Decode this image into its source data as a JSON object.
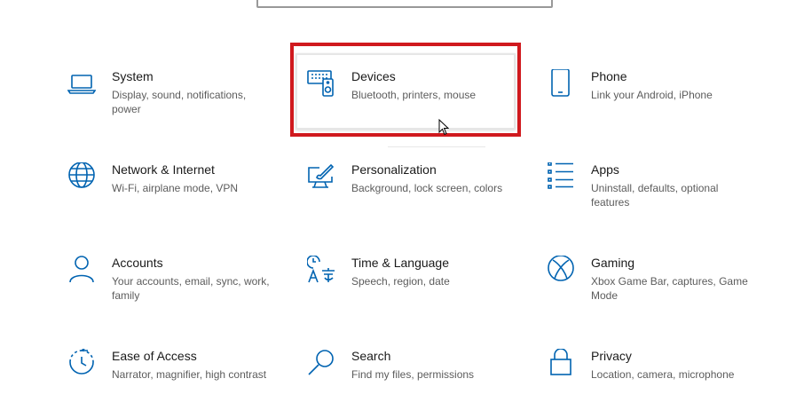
{
  "colors": {
    "accent": "#0063b1",
    "highlight": "#d0191e",
    "title_text": "#1a1a1a",
    "desc_text": "#5c5c5c"
  },
  "tiles": [
    {
      "title": "System",
      "description": "Display, sound, notifications, power",
      "icon": "laptop-icon"
    },
    {
      "title": "Devices",
      "description": "Bluetooth, printers, mouse",
      "icon": "devices-icon"
    },
    {
      "title": "Phone",
      "description": "Link your Android, iPhone",
      "icon": "phone-icon"
    },
    {
      "title": "Network & Internet",
      "description": "Wi-Fi, airplane mode, VPN",
      "icon": "globe-icon"
    },
    {
      "title": "Personalization",
      "description": "Background, lock screen, colors",
      "icon": "paint-icon"
    },
    {
      "title": "Apps",
      "description": "Uninstall, defaults, optional features",
      "icon": "apps-list-icon"
    },
    {
      "title": "Accounts",
      "description": "Your accounts, email, sync, work, family",
      "icon": "person-icon"
    },
    {
      "title": "Time & Language",
      "description": "Speech, region, date",
      "icon": "time-language-icon"
    },
    {
      "title": "Gaming",
      "description": "Xbox Game Bar, captures, Game Mode",
      "icon": "xbox-icon"
    },
    {
      "title": "Ease of Access",
      "description": "Narrator, magnifier, high contrast",
      "icon": "ease-of-access-icon"
    },
    {
      "title": "Search",
      "description": "Find my files, permissions",
      "icon": "search-icon"
    },
    {
      "title": "Privacy",
      "description": "Location, camera, microphone",
      "icon": "lock-icon"
    }
  ]
}
